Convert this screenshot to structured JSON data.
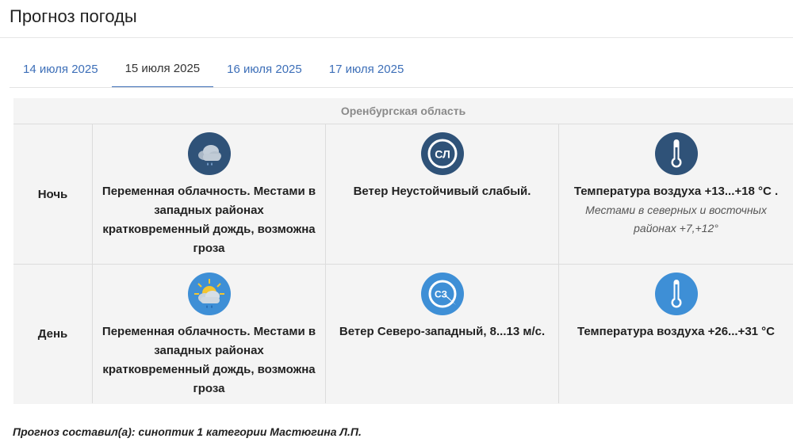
{
  "page": {
    "title": "Прогноз погоды"
  },
  "tabs": [
    {
      "label": "14 июля 2025",
      "active": false
    },
    {
      "label": "15 июля 2025",
      "active": true
    },
    {
      "label": "16 июля 2025",
      "active": false
    },
    {
      "label": "17 июля 2025",
      "active": false
    }
  ],
  "region": {
    "name": "Оренбургская область"
  },
  "forecast": {
    "night": {
      "label": "Ночь",
      "sky": {
        "icon": "cloud-rain-icon",
        "text": "Переменная облачность. Местами в западных районах кратковременный дождь, возможна гроза"
      },
      "wind": {
        "icon": "wind-direction-icon",
        "code": "СЛ",
        "text": "Ветер Неустойчивый слабый."
      },
      "temp": {
        "icon": "thermometer-icon",
        "text": "Температура воздуха +13...+18 °C .",
        "note": "Местами в северных и восточных районах +7,+12°"
      }
    },
    "day": {
      "label": "День",
      "sky": {
        "icon": "sun-cloud-rain-icon",
        "text": "Переменная облачность. Местами в западных районах кратковременный дождь, возможна гроза"
      },
      "wind": {
        "icon": "wind-direction-icon",
        "code": "СЗ",
        "text": "Ветер Северо-западный, 8...13 м/с."
      },
      "temp": {
        "icon": "thermometer-icon",
        "text": "Температура воздуха +26...+31 °C",
        "note": ""
      }
    }
  },
  "footer": {
    "author": "Прогноз составил(а): синоптик 1 категории Мастюгина Л.П."
  },
  "colors": {
    "night_icon": "#2f5278",
    "day_icon": "#3e8fd6",
    "link": "#3d6fb8"
  }
}
